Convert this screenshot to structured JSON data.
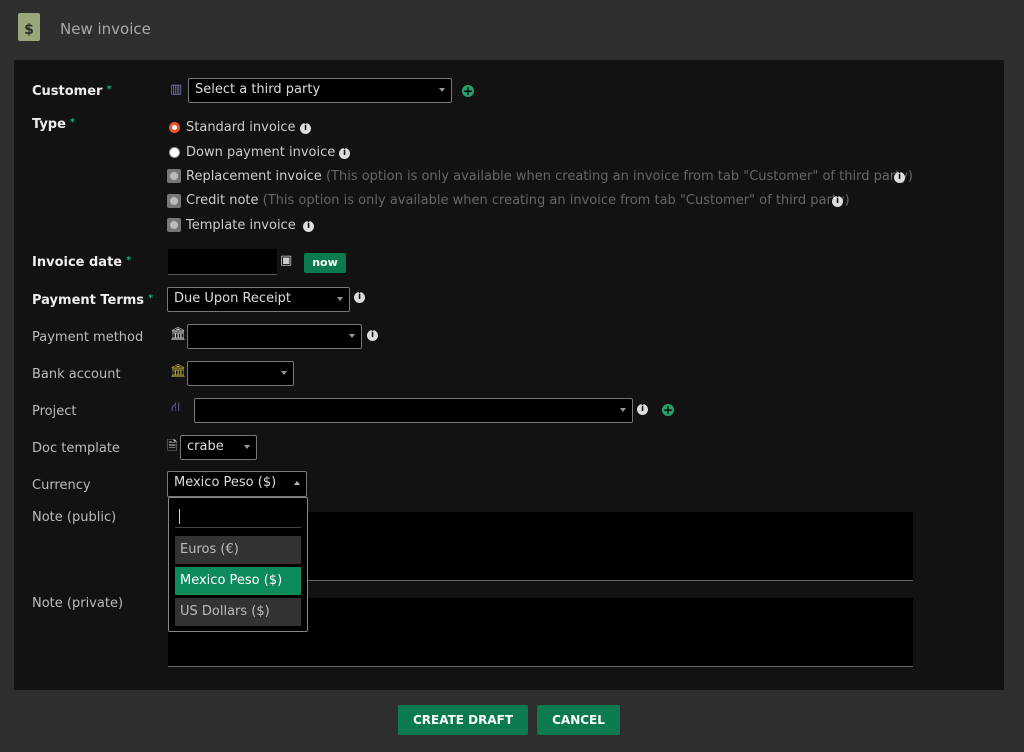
{
  "header": {
    "title": "New invoice",
    "icon": "invoice-dollar-icon"
  },
  "form": {
    "customer": {
      "label": "Customer",
      "placeholder": "Select a third party"
    },
    "type": {
      "label": "Type",
      "options": [
        {
          "label": "Standard invoice",
          "note": ""
        },
        {
          "label": "Down payment invoice",
          "note": ""
        },
        {
          "label": "Replacement invoice",
          "note": "(This option is only available when creating an invoice from tab \"Customer\" of third party)"
        },
        {
          "label": "Credit note",
          "note": "(This option is only available when creating an invoice from tab \"Customer\" of third party)"
        },
        {
          "label": "Template invoice",
          "note": ""
        }
      ]
    },
    "invoice_date": {
      "label": "Invoice date",
      "value": "",
      "now_label": "now"
    },
    "payment_terms": {
      "label": "Payment Terms",
      "value": "Due Upon Receipt"
    },
    "payment_method": {
      "label": "Payment method",
      "value": ""
    },
    "bank_account": {
      "label": "Bank account",
      "value": ""
    },
    "project": {
      "label": "Project",
      "value": ""
    },
    "doc_template": {
      "label": "Doc template",
      "value": "crabe"
    },
    "currency": {
      "label": "Currency",
      "value": "Mexico Peso ($)",
      "search": "",
      "options": [
        "Euros (€)",
        "Mexico Peso ($)",
        "US Dollars ($)"
      ]
    },
    "note_public": {
      "label": "Note (public)",
      "value": ""
    },
    "note_private": {
      "label": "Note (private)",
      "value": ""
    }
  },
  "buttons": {
    "create": "CREATE DRAFT",
    "cancel": "CANCEL"
  },
  "colors": {
    "accent": "#0b7a4e",
    "selected": "#0d8a5c",
    "radio": "#e8562a"
  }
}
